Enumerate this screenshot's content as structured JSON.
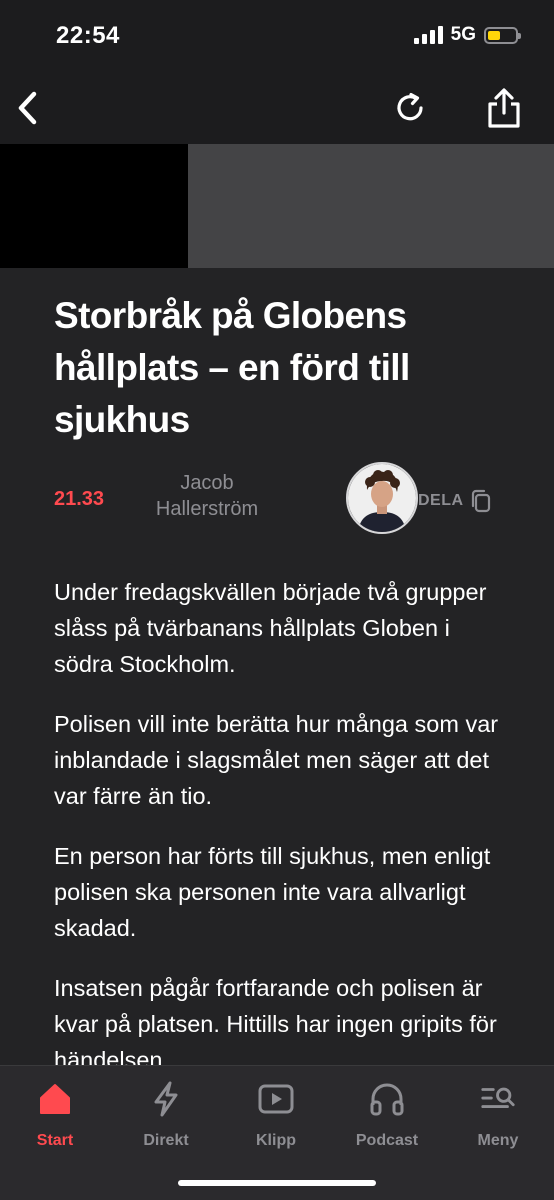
{
  "status_bar": {
    "time": "22:54",
    "network": "5G",
    "battery_level": 0.45,
    "battery_color": "#ffd60a"
  },
  "nav": {
    "back_icon": "chevron-left-icon",
    "reload_icon": "reload-icon",
    "share_icon": "share-icon"
  },
  "article": {
    "headline": "Storbråk på Globens hållplats – en förd till sjukhus",
    "time": "21.33",
    "author": "Jacob Hallerström",
    "share_label": "DELA",
    "paragraphs": [
      "Under fredagskvällen började två grupper slåss på tvärbanans hållplats Globen i södra Stockholm.",
      "Polisen vill inte berätta hur många som var inblandade i slagsmålet men säger att det var färre än tio.",
      "En person har förts till sjukhus, men enligt polisen ska personen inte vara allvarligt skadad.",
      "Insatsen pågår fortfarande och polisen är kvar på platsen. Hittills har ingen gripits för händelsen."
    ]
  },
  "tabs": [
    {
      "label": "Start",
      "icon": "home-icon",
      "active": true
    },
    {
      "label": "Direkt",
      "icon": "lightning-icon",
      "active": false
    },
    {
      "label": "Klipp",
      "icon": "play-icon",
      "active": false
    },
    {
      "label": "Podcast",
      "icon": "headphones-icon",
      "active": false
    },
    {
      "label": "Meny",
      "icon": "menu-search-icon",
      "active": false
    }
  ],
  "colors": {
    "accent": "#ff4a4f",
    "background": "#232325",
    "tab_inactive": "#8e8e93"
  }
}
